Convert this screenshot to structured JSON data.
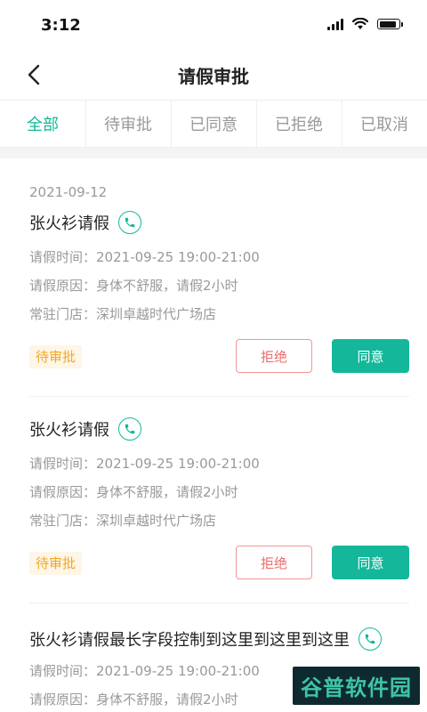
{
  "status_bar": {
    "time": "3:12"
  },
  "nav": {
    "title": "请假审批"
  },
  "tabs": [
    {
      "label": "全部",
      "active": true
    },
    {
      "label": "待审批",
      "active": false
    },
    {
      "label": "已同意",
      "active": false
    },
    {
      "label": "已拒绝",
      "active": false
    },
    {
      "label": "已取消",
      "active": false
    }
  ],
  "date_header": "2021-09-12",
  "labels": {
    "time": "请假时间：",
    "reason": "请假原因：",
    "store": "常驻门店："
  },
  "requests": [
    {
      "name": "张火衫请假",
      "time": "2021-09-25 19:00-21:00",
      "reason": "身体不舒服，请假2小时",
      "store": "深圳卓越时代广场店",
      "status": "待审批",
      "reject_label": "拒绝",
      "approve_label": "同意"
    },
    {
      "name": "张火衫请假",
      "time": "2021-09-25 19:00-21:00",
      "reason": "身体不舒服，请假2小时",
      "store": "深圳卓越时代广场店",
      "status": "待审批",
      "reject_label": "拒绝",
      "approve_label": "同意"
    },
    {
      "name": "张火衫请假最长字段控制到这里到这里到这里",
      "time": "2021-09-25 19:00-21:00",
      "reason": "身体不舒服，请假2小时"
    }
  ],
  "watermark": "谷普软件园",
  "colors": {
    "accent": "#14b79a",
    "reject": "#ee6a6a",
    "pending": "#f5a623"
  }
}
